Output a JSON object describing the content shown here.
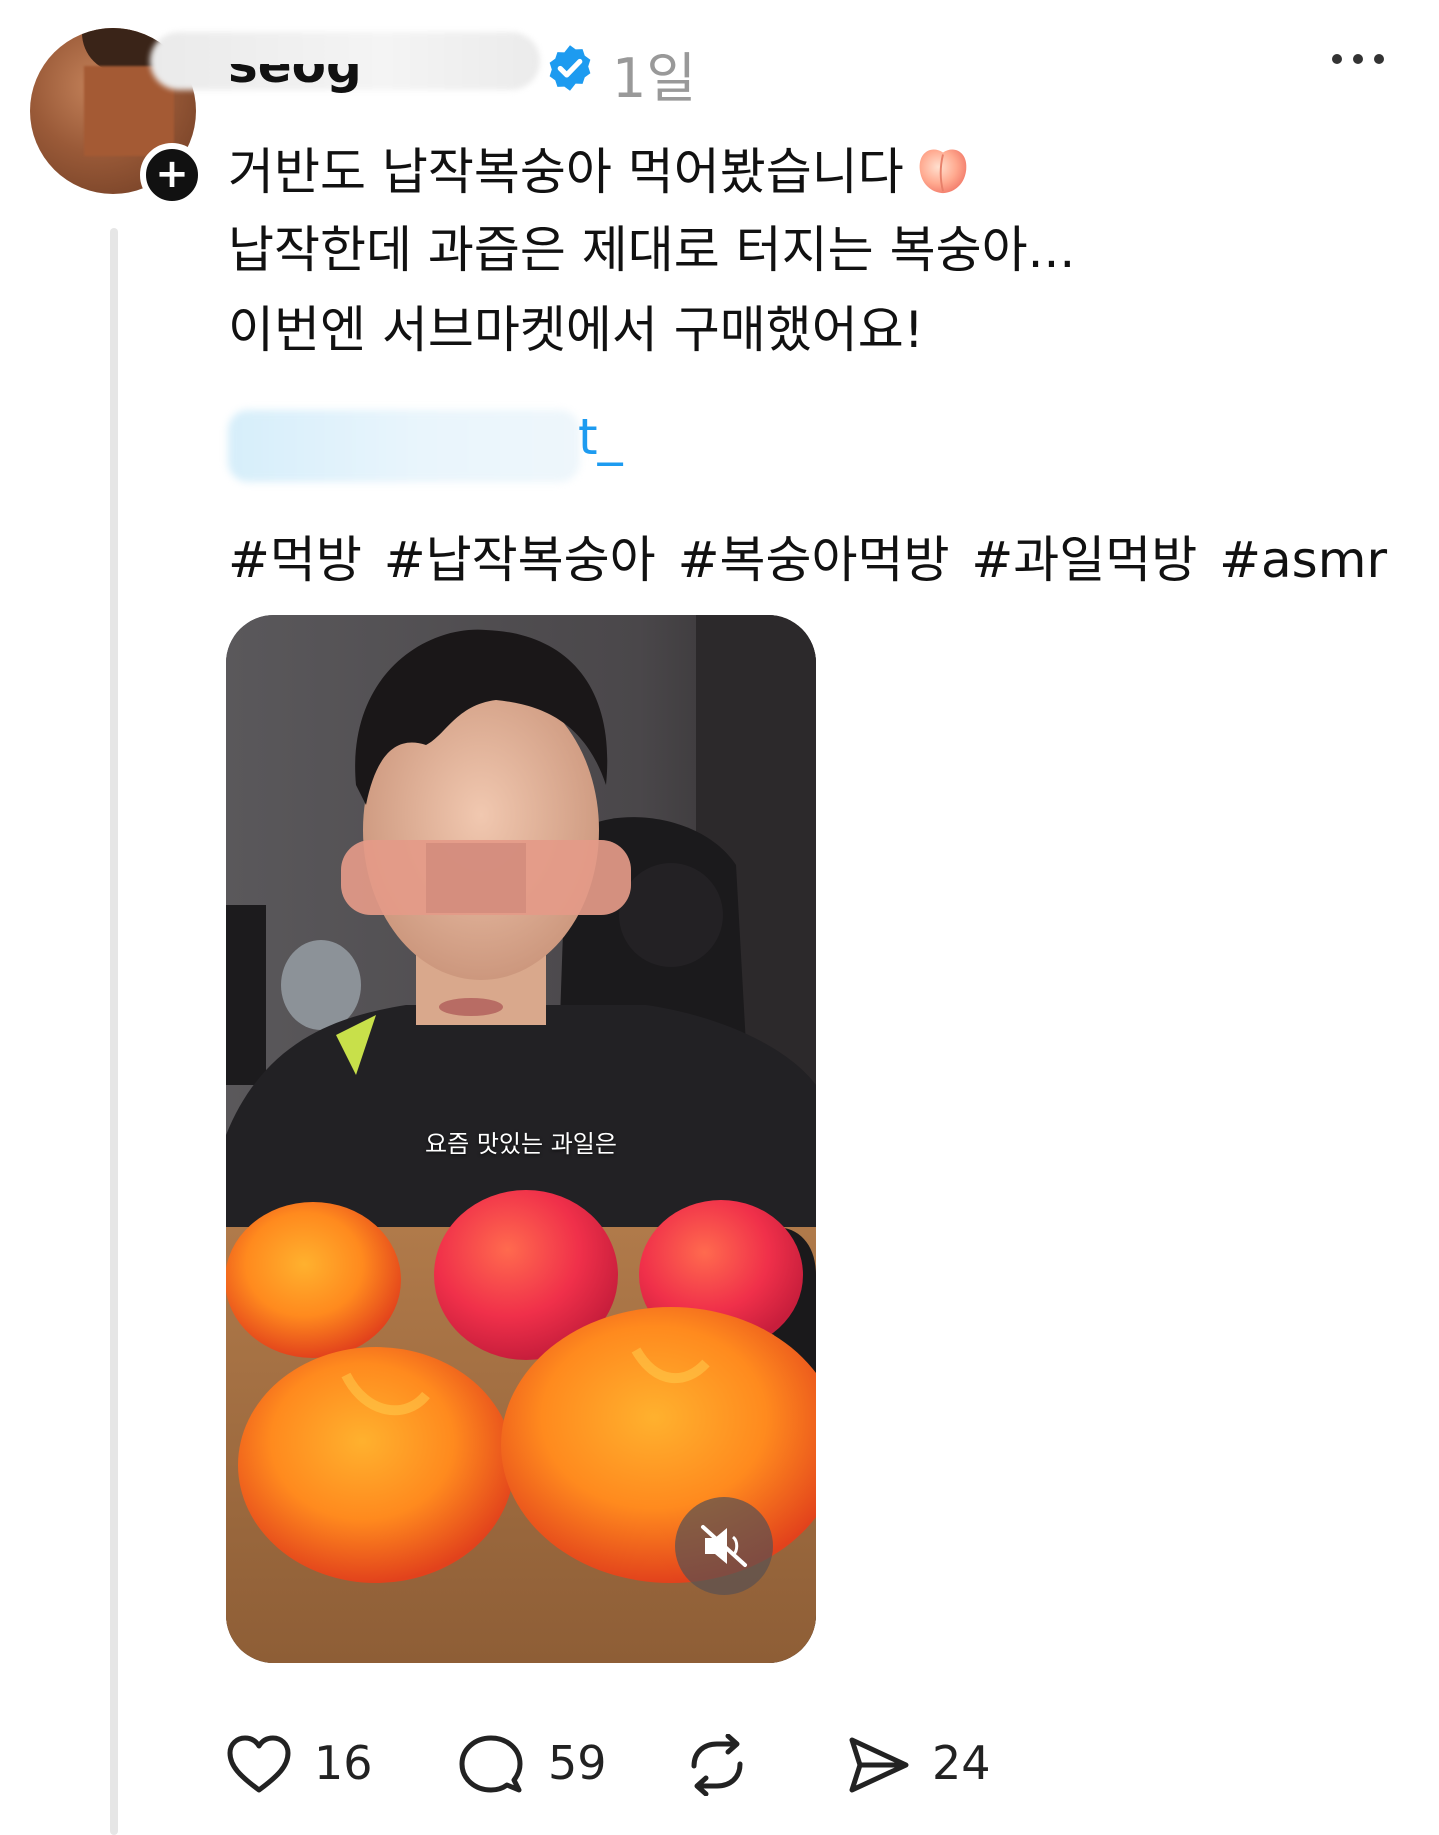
{
  "post": {
    "username": "seog",
    "verified": true,
    "timestamp": "1일",
    "lines": [
      "거반도 납작복숭아 먹어봤습니다",
      "납작한데 과즙은 제대로 터지는 복숭아...",
      "이번엔 서브마켓에서 구매했어요!"
    ],
    "emoji": "peach",
    "mention_visible": "t_",
    "hashtags": "#먹방 #납작복숭아 #복숭아먹방 #과일먹방 #asmr"
  },
  "video": {
    "caption": "요즘 맛있는 과일은",
    "muted": true
  },
  "actions": {
    "likes": "16",
    "replies": "59",
    "reposts": "",
    "shares": "24"
  },
  "icons": {
    "follow": "plus-icon",
    "verified": "verified-badge-icon",
    "more": "more-options-icon",
    "like": "heart-icon",
    "reply": "comment-icon",
    "repost": "repost-icon",
    "share": "send-icon",
    "mute": "speaker-muted-icon"
  },
  "colors": {
    "verified": "#1d9bf0",
    "mention": "#1d9bf0",
    "timestamp": "#999999"
  }
}
